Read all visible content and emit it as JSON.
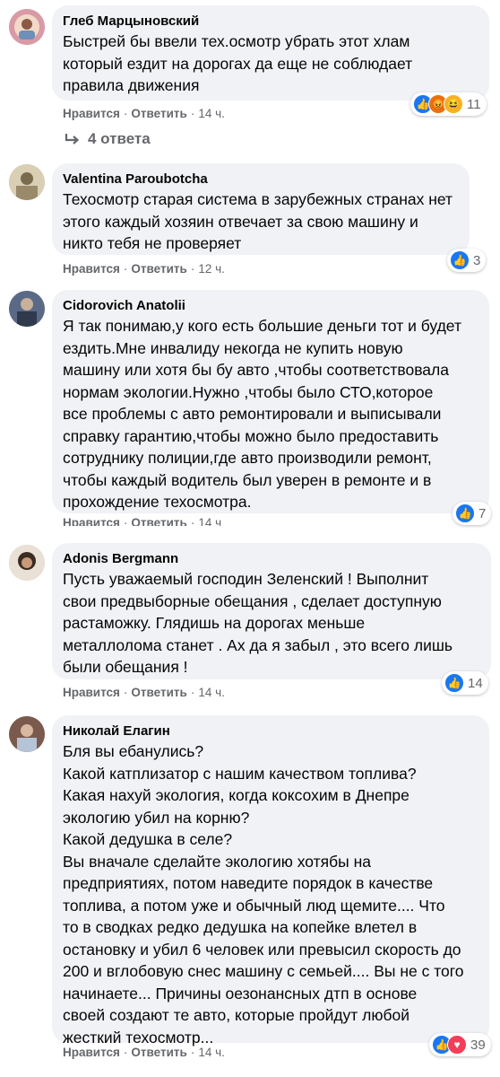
{
  "comments": [
    {
      "author": "Глеб Марцыновский",
      "text": "Быстрей бы ввели тех.осмотр убрать этот хлам\nкоторый ездит на дорогах да еще не соблюдает\nправила движения",
      "like": "Нравится",
      "reply": "Ответить",
      "time": "14 ч.",
      "reaction_count": "11",
      "reactions": [
        "like-icon",
        "angry-icon",
        "haha-icon"
      ],
      "replies": "4 ответа"
    },
    {
      "author": "Valentina Paroubotcha",
      "text": "Техосмотр старая система в зарубежных странах нет\nэтого каждый хозяин отвечает за свою машину и\nникто тебя не проверяет",
      "like": "Нравится",
      "reply": "Ответить",
      "time": "12 ч.",
      "reaction_count": "3",
      "reactions": [
        "like-icon"
      ]
    },
    {
      "author": "Cidorovich Anatolii",
      "text": "Я так понимаю,у кого есть большие деньги тот и будет\nездить.Мне инвалиду некогда не купить новую\nмашину или хотя бы бу авто ,чтобы соответствовала\nнормам экологии.Нужно ,чтобы было СТО,которое\nвсе проблемы с авто ремонтировали и выписывали\nсправку гарантию,чтобы можно было предоставить\nсотруднику полиции,где авто производили ремонт,\nчтобы каждый водитель был уверен в ремонте и в\nпрохождение техосмотра.",
      "like": "Нравится",
      "reply": "Ответить",
      "time": "14 ч",
      "reaction_count": "7",
      "reactions": [
        "like-icon"
      ]
    },
    {
      "author": "Adonis Bergmann",
      "text": "Пусть уважаемый господин Зеленский ! Выполнит\nсвои предвыборные обещания , сделает доступную\nрастаможку. Глядишь на дорогах меньше\nметаллолома станет . Ах да я забыл , это всего лишь\nбыли обещания !",
      "like": "Нравится",
      "reply": "Ответить",
      "time": "14 ч.",
      "reaction_count": "14",
      "reactions": [
        "like-icon"
      ]
    },
    {
      "author": "Николай Елагин",
      "text": "Бля вы ебанулись?\nКакой катплизатор с нашим качеством топлива?\nКакая нахуй экология, когда коксохим в Днепре\nэкологию убил на корню?\nКакой дедушка в селе?\nВы вначале сделайте экологию хотябы на\nпредприятиях, потом наведите порядок в качестве\nтоплива, а потом уже и обычный люд щемите.... Что\nто в сводках редко дедушка на копейке влетел в\nостановку и убил 6 человек или превысил скорость до\n200 и вглобовую снес машину с семьей.... Вы не с того\nначинаете... Причины оезонансных дтп в основе\nсвоей создают те авто, которые пройдут любой\nжесткий техосмотр...",
      "like": "Нравится",
      "reply": "Ответить",
      "time": "14 ч.",
      "reaction_count": "39",
      "reactions": [
        "like-icon",
        "love-icon"
      ]
    }
  ],
  "colors": {
    "bubble": "#f0f2f5",
    "secondary_text": "#65676b",
    "like_blue": "#1877f2",
    "love_red": "#f33e58"
  }
}
